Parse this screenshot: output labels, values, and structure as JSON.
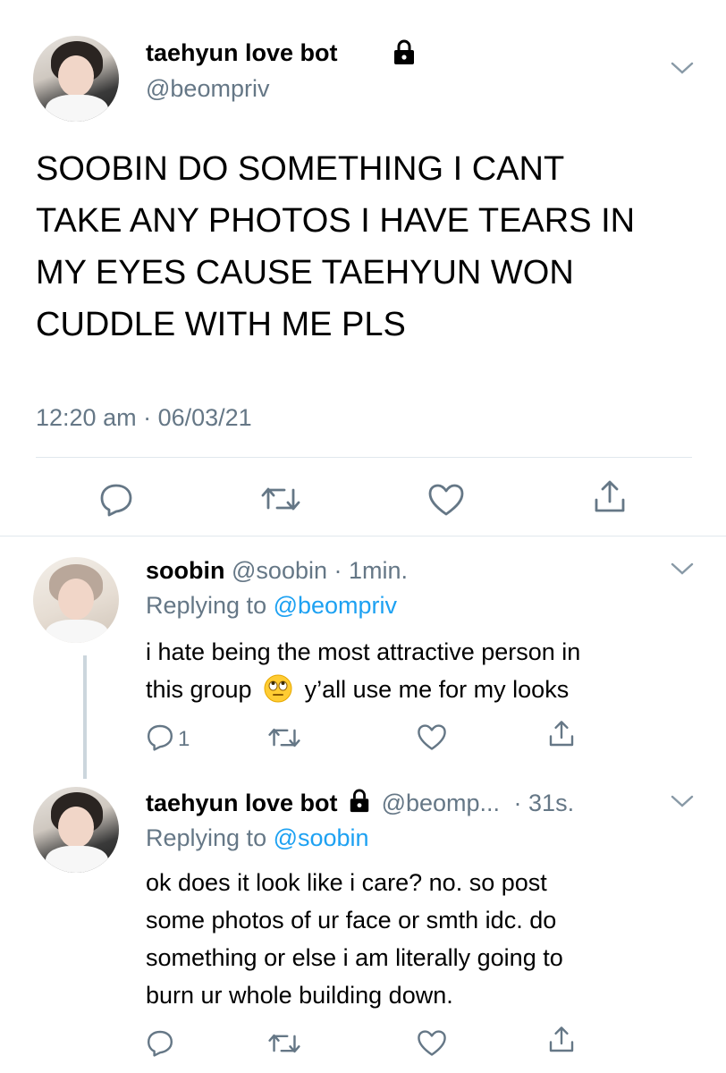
{
  "main_tweet": {
    "display_name": "taehyun love bot",
    "handle": "@beompriv",
    "text_lines": [
      "SOOBIN DO SOMETHING I CANT",
      "TAKE ANY PHOTOS I HAVE TEARS IN",
      "MY EYES CAUSE TAEHYUN WON",
      "CUDDLE WITH ME PLS"
    ],
    "timestamp": "12:20 am · 06/03/21"
  },
  "reply1": {
    "display_name": "soobin",
    "handle": "@soobin",
    "time": "· 1min.",
    "replying_prefix": "Replying to ",
    "replying_to": "@beompriv",
    "text_line1": "i hate being the most attractive person in",
    "text_line2_a": "this group",
    "text_line2_b": "y’all use me for my looks",
    "reply_count": "1"
  },
  "reply2": {
    "display_name": "taehyun love bot",
    "handle": "@beomp...",
    "time": "· 31s.",
    "replying_prefix": "Replying to ",
    "replying_to": "@soobin",
    "text_lines": [
      "ok does it look like i care? no. so post",
      "some photos of ur face or smth idc. do",
      "something or else i am literally going to",
      "burn ur whole building down."
    ]
  },
  "colors": {
    "link": "#1da1f2",
    "secondary": "#657786",
    "divider": "#e1e8ed"
  },
  "icons": [
    "lock-icon",
    "chevron-down-icon",
    "reply-icon",
    "retweet-icon",
    "like-icon",
    "share-icon",
    "eye-roll-emoji"
  ]
}
